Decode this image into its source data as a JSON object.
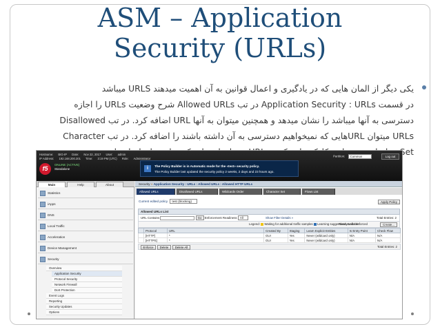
{
  "slide": {
    "title_line1": "ASM – Application",
    "title_line2": "Security (URLs)",
    "bullet_lines": [
      "یکی دیگر از المان هایی که در یادگیری و اعمال قوانین به آن اهمیت میدهند URLS میباشد",
      "در قسمت Application Security : URLs در تب Allowed URLs شرح وضعیت URLs را اجازه",
      "دسترسی به آنها میباشد را نشان میدهد و همچنین میتوان به آنها URL اضافه کرد. در تب  Disallowed",
      "URLs میتوان URLهایی که نمیخواهیم دسترسی به آن داشته باشند را اضافه کرد. در تب  Character",
      "Set تنظیمات مربوط به کارکترهایی که در URL میتوان استفاده کرد را میتوان انجام داد."
    ]
  },
  "screenshot": {
    "host": {
      "hostname_label": "Hostname:",
      "hostname": "BIG-IP",
      "ip_label": "IP Address:",
      "ip": "192.168.200.201",
      "date_label": "Date:",
      "date": "Nov 22, 2017",
      "time_label": "Time:",
      "time": "3:19 PM (UTC)",
      "user_label": "User:",
      "user": "admin",
      "role_label": "Role:",
      "role": "Administrator"
    },
    "logo_text": "f5",
    "status_line1": "ONLINE (ACTIVE)",
    "status_line2": "Standalone",
    "partition_label": "Partition:",
    "partition_value": "Common",
    "logout_label": "Log out",
    "notice": {
      "icon": "i",
      "line1": "The Policy Builder is in Automatic mode for the «test» security policy.",
      "line2": "The Policy Builder last updated the security policy 2 weeks, 2 days and 23 hours ago."
    },
    "left_tabs": [
      "Main",
      "Help",
      "About"
    ],
    "nav_sections": [
      "Statistics",
      "iApps",
      "DNS",
      "Local Traffic",
      "Acceleration",
      "Device Management",
      "Security"
    ],
    "security_items": [
      {
        "label": "Overview",
        "level": 1
      },
      {
        "label": "Application Security",
        "level": 2
      },
      {
        "label": "Protocol Security",
        "level": 2
      },
      {
        "label": "Network Firewall",
        "level": 2
      },
      {
        "label": "DoS Protection",
        "level": 2
      },
      {
        "label": "Event Logs",
        "level": 1
      },
      {
        "label": "Reporting",
        "level": 1
      },
      {
        "label": "Security Updates",
        "level": 1
      },
      {
        "label": "Options",
        "level": 1
      }
    ],
    "breadcrumb": {
      "root": "Security",
      "sep": "»",
      "path": "Application Security : URLs : Allowed URLs : Allowed HTTP URLs"
    },
    "main_tabs": [
      "Allowed URLs",
      "Disallowed URLs",
      "Wildcards Order",
      "Character Set",
      "Flows List"
    ],
    "policy": {
      "label": "Current edited policy",
      "value": "test (blocking)",
      "apply_label": "Apply Policy"
    },
    "allowed_panel": {
      "title": "Allowed URLs List",
      "url_contains_label": "URL Contains",
      "go_label": "Go",
      "enforcement_label": "Enforcement Readiness",
      "enforcement_value": "All",
      "show_filter_label": "Show Filter Details »",
      "total_entries": "Total Entries: 2"
    },
    "toolbar": {
      "legend_label": "Legend:",
      "legend_waiting": "Waiting for additional traffic samples",
      "legend_learning": "Learning suggestions available",
      "ready_label": "Ready to be enforced",
      "create_label": "Create..."
    },
    "table": {
      "columns": [
        "Protocol",
        "URL",
        "Created By",
        "Staging",
        "Learn Explicit Entities",
        "Is Entry Point",
        "Check Flow"
      ],
      "rows": [
        [
          "[HTTP]",
          "*",
          "GUI",
          "Yes",
          "Never (wildcard only)",
          "N/A",
          "N/A"
        ],
        [
          "[HTTPS]",
          "*",
          "GUI",
          "Yes",
          "Never (wildcard only)",
          "N/A",
          "N/A"
        ]
      ]
    },
    "bottom_buttons": [
      "Enforce",
      "Delete",
      "Delete All"
    ],
    "bottom_total": "Total Entries: 2"
  }
}
